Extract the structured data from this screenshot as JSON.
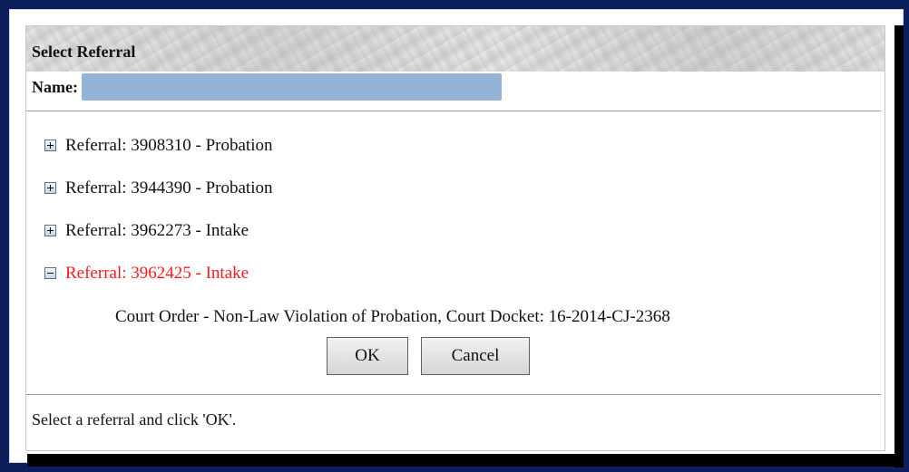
{
  "dialog": {
    "title": "Select Referral",
    "name_label": "Name:",
    "name_value": ""
  },
  "referrals": [
    {
      "label": "Referral: 3908310 - Probation",
      "expanded": false
    },
    {
      "label": "Referral: 3944390 - Probation",
      "expanded": false
    },
    {
      "label": "Referral: 3962273 - Intake",
      "expanded": false
    },
    {
      "label": "Referral: 3962425 - Intake",
      "expanded": true
    }
  ],
  "selected_detail": "Court Order - Non-Law Violation of Probation, Court Docket: 16-2014-CJ-2368",
  "buttons": {
    "ok": "OK",
    "cancel": "Cancel"
  },
  "status": "Select a referral and click 'OK'.",
  "colors": {
    "active_referral": "#ff1a1a",
    "name_redaction": "#94b3d9",
    "background": "#0b1f5c"
  }
}
